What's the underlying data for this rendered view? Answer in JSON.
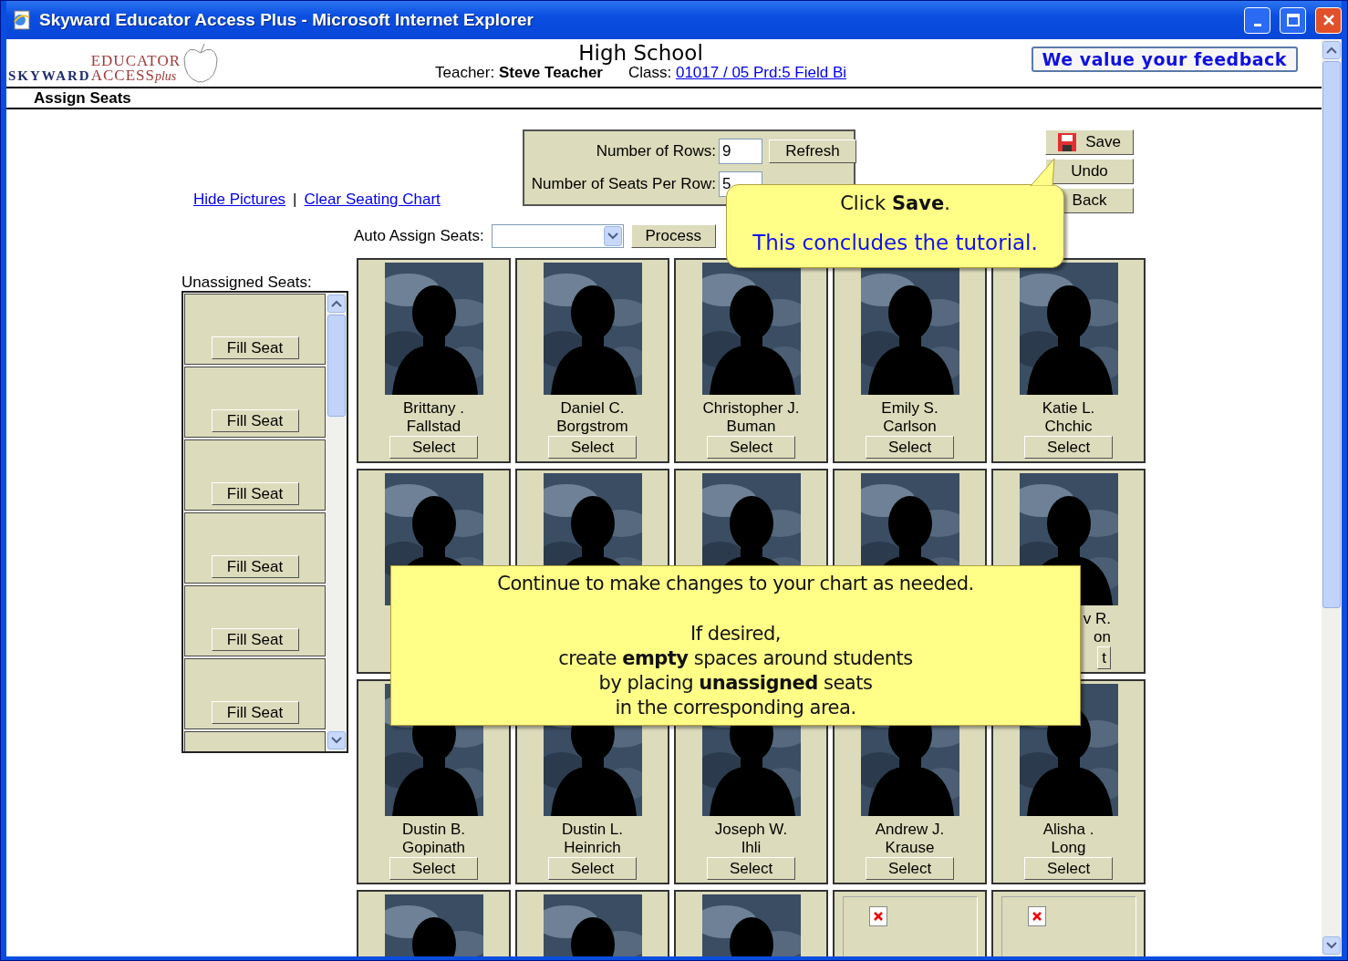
{
  "window": {
    "title": "Skyward Educator Access Plus - Microsoft Internet Explorer"
  },
  "logo": {
    "brand": "SKYWARD",
    "line1": "EDUCATOR",
    "line2": "ACCESS",
    "suffix": "plus"
  },
  "header": {
    "school": "High School",
    "teacher_label": "Teacher:",
    "teacher": "Steve Teacher",
    "class_label": "Class:",
    "class_link": "01017 / 05 Prd:5 Field Bi",
    "feedback_button": "We value your feedback"
  },
  "page_title": "Assign Seats",
  "links": [
    {
      "label": "Hide Pictures"
    },
    {
      "label": "Clear Seating Chart"
    }
  ],
  "link_separator": "|",
  "settings": {
    "rows_label": "Number of Rows:",
    "rows_value": "9",
    "refresh_button": "Refresh",
    "seats_label": "Number of Seats Per Row:",
    "seats_value": "5"
  },
  "auto_assign": {
    "label": "Auto Assign Seats:",
    "process_button": "Process"
  },
  "actions": [
    {
      "label": "Save",
      "kind": "save"
    },
    {
      "label": "Undo",
      "kind": "plain"
    },
    {
      "label": "Back",
      "kind": "plain"
    }
  ],
  "unassigned": {
    "label": "Unassigned Seats:",
    "slots": [
      {
        "button": "Fill Seat"
      },
      {
        "button": "Fill Seat"
      },
      {
        "button": "Fill Seat"
      },
      {
        "button": "Fill Seat"
      },
      {
        "button": "Fill Seat"
      },
      {
        "button": "Fill Seat"
      }
    ]
  },
  "seat_rows": [
    [
      {
        "kind": "student",
        "first": "Brittany .",
        "last": "Fallstad",
        "button": "Select"
      },
      {
        "kind": "student",
        "first": "Daniel C.",
        "last": "Borgstrom",
        "button": "Select"
      },
      {
        "kind": "student",
        "first": "Christopher J.",
        "last": "Buman",
        "button": "Select"
      },
      {
        "kind": "student",
        "first": "Emily S.",
        "last": "Carlson",
        "button": "Select"
      },
      {
        "kind": "student",
        "first": "Katie L.",
        "last": "Chchic",
        "button": "Select"
      }
    ],
    [
      {
        "kind": "photo_only"
      },
      {
        "kind": "photo_only"
      },
      {
        "kind": "photo_only"
      },
      {
        "kind": "photo_only"
      },
      {
        "kind": "partial",
        "first": "v R.",
        "last": "on",
        "button": "t"
      }
    ],
    [
      {
        "kind": "student",
        "first": "Dustin B.",
        "last": "Gopinath",
        "button": "Select"
      },
      {
        "kind": "student",
        "first": "Dustin L.",
        "last": "Heinrich",
        "button": "Select"
      },
      {
        "kind": "student",
        "first": "Joseph W.",
        "last": "Ihli",
        "button": "Select"
      },
      {
        "kind": "student",
        "first": "Andrew J.",
        "last": "Krause",
        "button": "Select"
      },
      {
        "kind": "student",
        "first": "Alisha .",
        "last": "Long",
        "button": "Select"
      }
    ],
    [
      {
        "kind": "photo_only"
      },
      {
        "kind": "photo_only"
      },
      {
        "kind": "photo_only"
      },
      {
        "kind": "broken"
      },
      {
        "kind": "broken"
      }
    ]
  ],
  "callouts": [
    {
      "kind": "pointer",
      "paragraphs": [
        {
          "text": "Click **Save**.",
          "highlight": false
        },
        {
          "text": "This concludes the tutorial.",
          "highlight": true
        }
      ]
    },
    {
      "kind": "box",
      "paragraphs": [
        {
          "text": "Continue to make changes to your chart as needed.",
          "highlight": false
        },
        {
          "text": "If desired,\ncreate **empty** spaces around students\nby placing **unassigned** seats\nin the corresponding area.",
          "highlight": false
        }
      ]
    }
  ]
}
